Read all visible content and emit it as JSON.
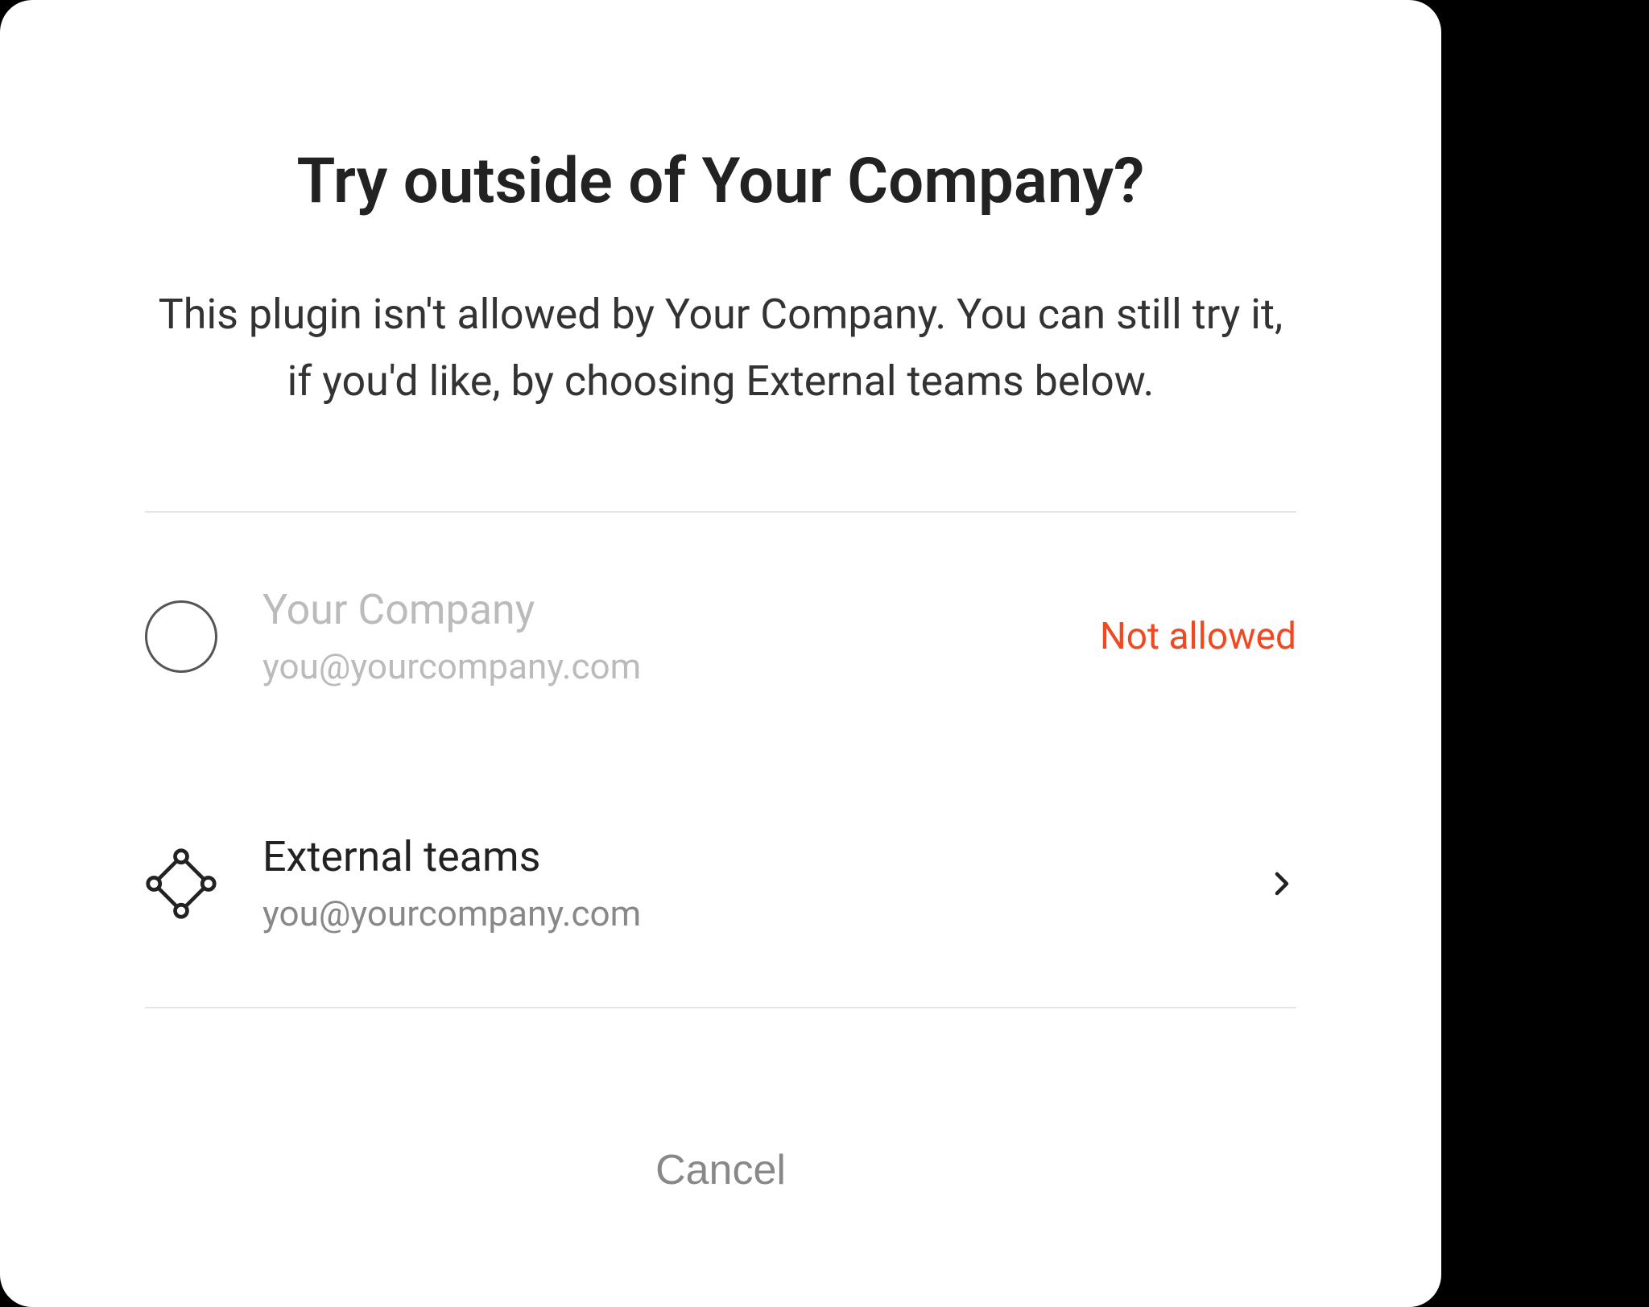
{
  "modal": {
    "title": "Try outside of Your Company?",
    "description": "This plugin isn't allowed by Your Company. You can still try it, if you'd like, by choosing External teams below.",
    "options": [
      {
        "title": "Your Company",
        "subtitle": "you@yourcompany.com",
        "status": "Not allowed",
        "disabled": true
      },
      {
        "title": "External teams",
        "subtitle": "you@yourcompany.com",
        "disabled": false
      }
    ],
    "cancel_label": "Cancel"
  },
  "colors": {
    "error": "#f24822",
    "text_primary": "#222",
    "text_secondary": "#888",
    "text_disabled": "#bbb"
  }
}
